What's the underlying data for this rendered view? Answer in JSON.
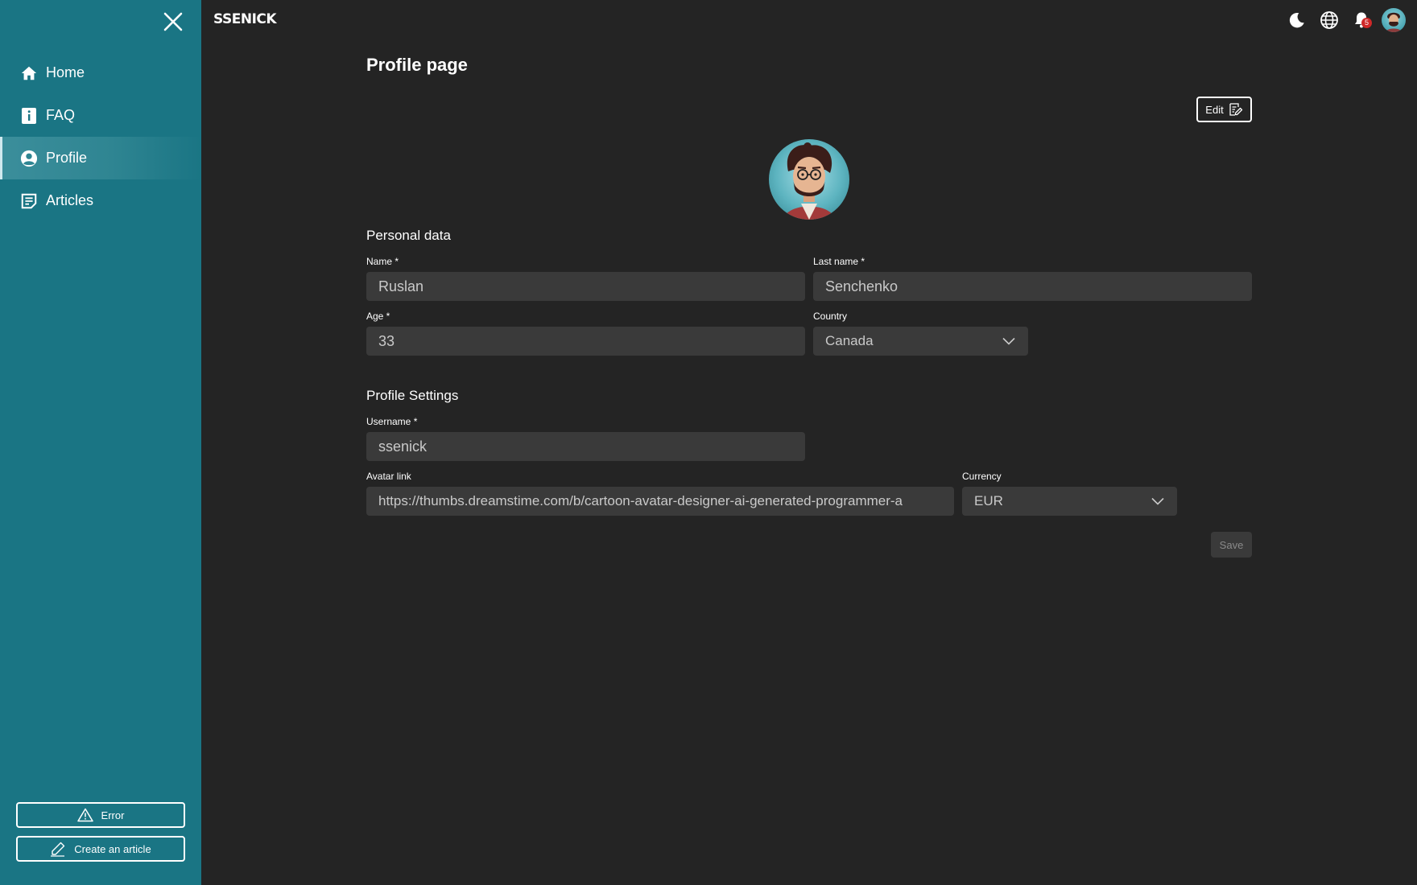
{
  "app": {
    "logo": "SSENICK"
  },
  "sidebar": {
    "items": [
      {
        "label": "Home",
        "icon": "home-icon"
      },
      {
        "label": "FAQ",
        "icon": "info-book-icon"
      },
      {
        "label": "Profile",
        "icon": "user-circle-icon",
        "active": true
      },
      {
        "label": "Articles",
        "icon": "article-icon"
      }
    ],
    "error_button": "Error",
    "create_button": "Create an article"
  },
  "header": {
    "notifications_count": "5"
  },
  "page": {
    "title": "Profile page",
    "edit_label": "Edit",
    "save_label": "Save"
  },
  "personal": {
    "title": "Personal data",
    "name_label": "Name *",
    "name_value": "Ruslan",
    "lastname_label": "Last name *",
    "lastname_value": "Senchenko",
    "age_label": "Age *",
    "age_value": "33",
    "country_label": "Country",
    "country_value": "Canada"
  },
  "settings": {
    "title": "Profile Settings",
    "username_label": "Username *",
    "username_value": "ssenick",
    "avatar_label": "Avatar link",
    "avatar_value": "https://thumbs.dreamstime.com/b/cartoon-avatar-designer-ai-generated-programmer-a",
    "currency_label": "Currency",
    "currency_value": "EUR"
  },
  "colors": {
    "sidebar": "#1a7584",
    "background": "#242424",
    "input": "#3a3a3a",
    "badge": "#d02828"
  }
}
